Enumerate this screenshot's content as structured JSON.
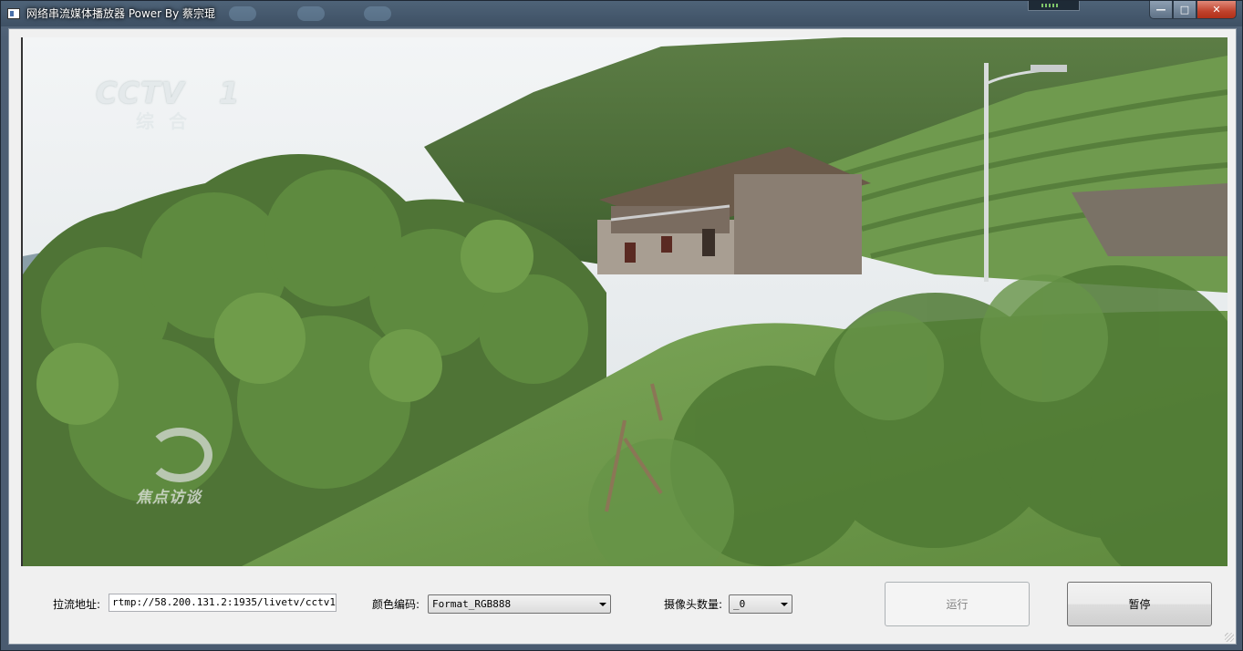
{
  "window": {
    "title": "网络串流媒体播放器 Power By 蔡宗琨",
    "minimize": "—",
    "maximize": "□",
    "close": "✕"
  },
  "video": {
    "channel_logo": "CCTV",
    "channel_number": "1",
    "channel_sub": "综合",
    "program_logo": "焦点访谈"
  },
  "controls": {
    "url_label": "拉流地址:",
    "url_value": "rtmp://58.200.131.2:1935/livetv/cctv1",
    "color_label": "颜色编码:",
    "color_value": "Format_RGB888",
    "camera_label": "摄像头数量:",
    "camera_value": "_0",
    "run_button": "运行",
    "pause_button": "暂停"
  }
}
